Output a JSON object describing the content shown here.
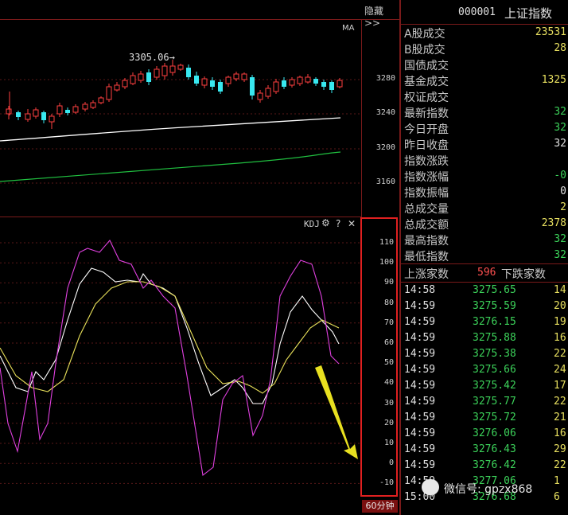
{
  "toolbar": {
    "hide_label": "隐藏>>",
    "period_label": "60分钟"
  },
  "price_panel": {
    "ma_label": "MA",
    "peak_annotation": "3305.06→",
    "y_ticks": [
      "3280",
      "3240",
      "3200",
      "3160"
    ]
  },
  "kdj_panel": {
    "title": "KDJ",
    "gear_label": "⚙",
    "help_label": "?",
    "close_label": "✕",
    "y_ticks": [
      "110",
      "100",
      "90",
      "80",
      "70",
      "60",
      "50",
      "40",
      "30",
      "20",
      "10",
      "0",
      "-10"
    ]
  },
  "colors": {
    "k_line": "#ffffff",
    "d_line": "#e8e05a",
    "j_line": "#e040e0",
    "up": "#ff4040",
    "down": "#38e8f0",
    "ma_white": "#ffffff",
    "ma_green": "#20c040",
    "frame": "#e02020"
  },
  "quote": {
    "code": "000001",
    "name": "上证指数",
    "rows": [
      {
        "label": "A股成交",
        "value": "23531",
        "color": "#e8e060"
      },
      {
        "label": "B股成交",
        "value": "28",
        "color": "#e8e060"
      },
      {
        "label": "国债成交",
        "value": "",
        "color": "#e8e060"
      },
      {
        "label": "基金成交",
        "value": "1325",
        "color": "#e8e060"
      },
      {
        "label": "权证成交",
        "value": "",
        "color": "#e8e060"
      },
      {
        "label": "最新指数",
        "value": "32",
        "color": "#3cd25a"
      },
      {
        "label": "今日开盘",
        "value": "32",
        "color": "#3cd25a"
      },
      {
        "label": "昨日收盘",
        "value": "32",
        "color": "#e0e0e0"
      },
      {
        "label": "指数涨跌",
        "value": "",
        "color": "#3cd25a"
      },
      {
        "label": "指数涨幅",
        "value": "-0",
        "color": "#3cd25a"
      },
      {
        "label": "指数振幅",
        "value": "0",
        "color": "#e0e0e0"
      },
      {
        "label": "总成交量",
        "value": "2",
        "color": "#e8e060"
      },
      {
        "label": "总成交额",
        "value": "2378",
        "color": "#e8e060"
      },
      {
        "label": "最高指数",
        "value": "32",
        "color": "#3cd25a"
      },
      {
        "label": "最低指数",
        "value": "32",
        "color": "#3cd25a"
      }
    ],
    "breadth": {
      "up_label": "上涨家数",
      "up_count": "596",
      "down_label": "下跌家数"
    }
  },
  "ticks": [
    {
      "time": "14:58",
      "price": "3275.65",
      "vol": "14"
    },
    {
      "time": "14:59",
      "price": "3275.59",
      "vol": "20"
    },
    {
      "time": "14:59",
      "price": "3276.15",
      "vol": "19"
    },
    {
      "time": "14:59",
      "price": "3275.88",
      "vol": "16"
    },
    {
      "time": "14:59",
      "price": "3275.38",
      "vol": "22"
    },
    {
      "time": "14:59",
      "price": "3275.66",
      "vol": "24"
    },
    {
      "time": "14:59",
      "price": "3275.42",
      "vol": "17"
    },
    {
      "time": "14:59",
      "price": "3275.77",
      "vol": "22"
    },
    {
      "time": "14:59",
      "price": "3275.72",
      "vol": "21"
    },
    {
      "time": "14:59",
      "price": "3276.06",
      "vol": "16"
    },
    {
      "time": "14:59",
      "price": "3276.43",
      "vol": "29"
    },
    {
      "time": "14:59",
      "price": "3276.42",
      "vol": "22"
    },
    {
      "time": "14:59",
      "price": "3277.06",
      "vol": "1"
    },
    {
      "time": "15:00",
      "price": "3276.68",
      "vol": "6"
    }
  ],
  "watermark": {
    "text": "微信号: gpzx868"
  }
}
